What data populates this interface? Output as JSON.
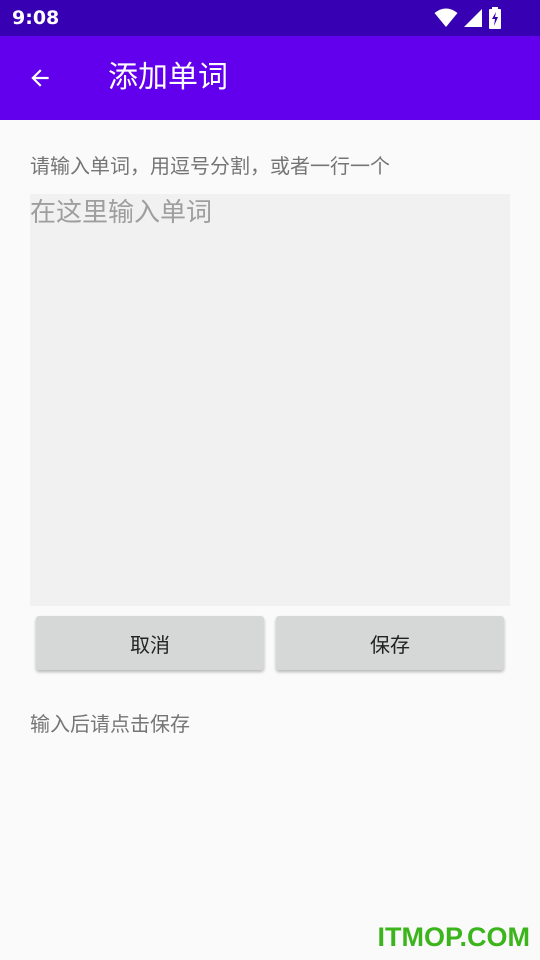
{
  "status_bar": {
    "time": "9:08",
    "icons": [
      "wifi-icon",
      "signal-icon",
      "battery-charging-icon"
    ]
  },
  "app_bar": {
    "back_icon": "arrow-left-icon",
    "title": "添加单词",
    "background": "#6200ee",
    "status_background": "#3700b3"
  },
  "form": {
    "instruction": "请输入单词，用逗号分割，或者一行一个",
    "input_placeholder": "在这里输入单词",
    "input_value": "",
    "cancel_label": "取消",
    "save_label": "保存",
    "footer_hint": "输入后请点击保存"
  },
  "watermark": {
    "text": "ITMOP.COM",
    "color": "#3cb51c"
  }
}
